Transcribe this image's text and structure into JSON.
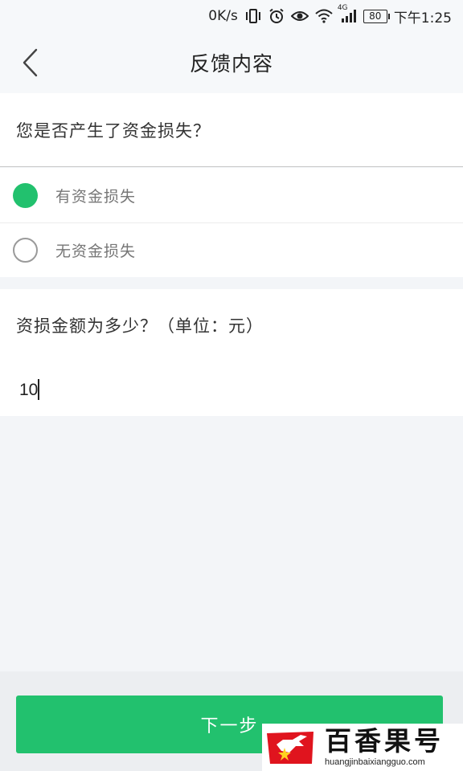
{
  "status_bar": {
    "net_speed": "0K/s",
    "network_type": "4G",
    "battery": "80",
    "time": "下午1:25",
    "icons": [
      "vibrate-icon",
      "alarm-icon",
      "eye-icon",
      "wifi-icon",
      "signal-icon",
      "battery-icon"
    ]
  },
  "header": {
    "title": "反馈内容",
    "back_icon": "chevron-left-icon"
  },
  "question1": {
    "text": "您是否产生了资金损失？",
    "options": [
      {
        "label": "有资金损失",
        "selected": true
      },
      {
        "label": "无资金损失",
        "selected": false
      }
    ]
  },
  "question2": {
    "text": "资损金额为多少？（单位：元）",
    "value": "10"
  },
  "footer": {
    "next_label": "下一步"
  },
  "watermark": {
    "name": "百香果号",
    "url": "huangjinbaixiangguo.com"
  },
  "colors": {
    "accent": "#22c16e",
    "background": "#f3f5f8"
  }
}
